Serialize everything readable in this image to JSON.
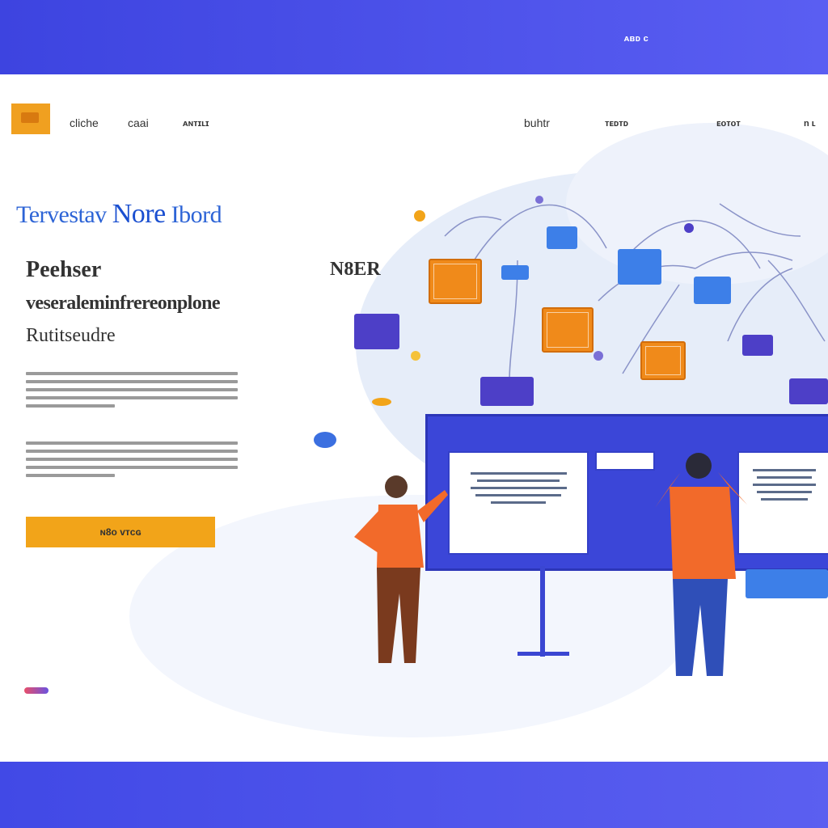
{
  "top_band": {
    "label": "ᴀʙᴅ ᴄ"
  },
  "header": {
    "nav_left": [
      "cliche",
      "caai",
      "ᴀɴᴛɪʟɪ"
    ],
    "nav_right": [
      "buhtr",
      "ᴛᴇᴅᴛᴅ",
      "ᴇᴏᴛᴏᴛ",
      "n ʟ"
    ]
  },
  "hero": {
    "title_part1": "Tervestav",
    "title_part2": "Nore",
    "title_part3": "Ibord",
    "subtitle_line1": "Peehser",
    "subtitle_line1_right": "N8ER",
    "subtitle_line2": "veseraleminfrereonplone",
    "subtitle_line3": "Rutitseudre"
  },
  "cta": {
    "label": "ɴ8ᴏ ᴠᴛᴄɢ"
  },
  "colors": {
    "brand": "#4a52e8",
    "accent": "#f2a419",
    "title": "#2d64d6"
  }
}
